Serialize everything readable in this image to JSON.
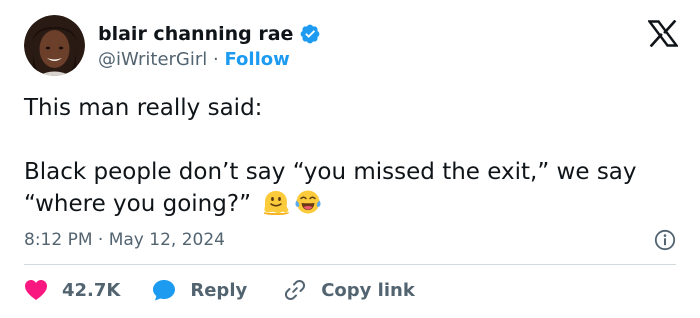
{
  "author": {
    "display_name": "blair channing rae",
    "handle": "@iWriterGirl",
    "separator": "·",
    "follow_label": "Follow",
    "verified": true
  },
  "icons": {
    "brand": "x-logo-icon",
    "verified": "verified-badge-icon",
    "info": "info-icon",
    "like": "heart-icon",
    "reply": "reply-bubble-icon",
    "copy_link": "link-icon",
    "emoji_1": "melting-face-emoji",
    "emoji_2": "tears-of-joy-emoji"
  },
  "tweet": {
    "text": "This man really said:\n\nBlack people don’t say “you missed the exit,” we say “where you going?” ",
    "timestamp": "8:12 PM · May 12, 2024"
  },
  "actions": {
    "likes": "42.7K",
    "reply_label": "Reply",
    "copy_link_label": "Copy link"
  },
  "colors": {
    "accent": "#1d9bf0",
    "like": "#f91880",
    "text_primary": "#0f1419",
    "text_secondary": "#536471",
    "divider": "#cfd9de"
  }
}
